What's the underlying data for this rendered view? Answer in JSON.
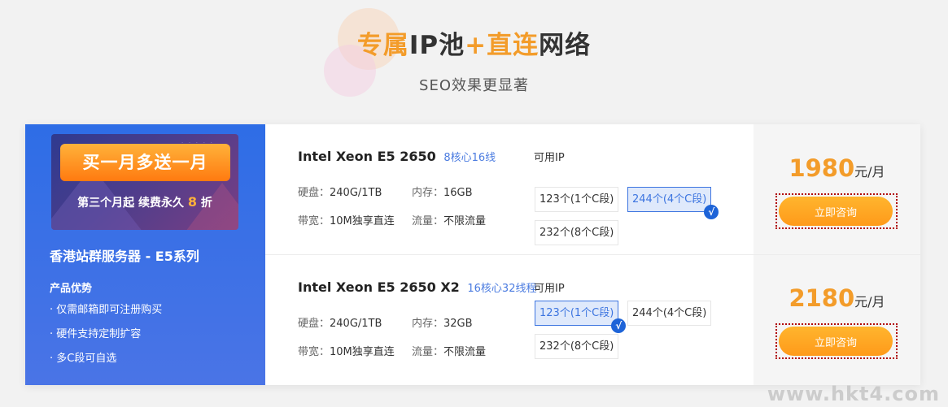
{
  "header": {
    "title_part1": "专属",
    "title_part2": "IP池",
    "title_plus": "+",
    "title_part3": "直连",
    "title_part4": "网络",
    "subtitle": "SEO效果更显著"
  },
  "colors": {
    "accent_orange": "#f39c2a",
    "brand_blue": "#2e6de6",
    "select_blue": "#3d75e0"
  },
  "side": {
    "banner_main": "买一月多送一月",
    "banner_sub_prefix": "第三个月起  续费永久",
    "banner_sub_num": "8",
    "banner_sub_suffix": "折",
    "title": "香港站群服务器 - E5系列",
    "advantages_heading": "产品优势",
    "advantages": [
      "· 仅需邮箱即可注册购买",
      "· 硬件支持定制扩容",
      "· 多C段可自选"
    ]
  },
  "products": [
    {
      "cpu": "Intel Xeon E5 2650",
      "cores": "8核心16线",
      "disk_label": "硬盘：",
      "disk": "240G/1TB",
      "mem_label": "内存：",
      "mem": "16GB",
      "bw_label": "带宽：",
      "bw": "10M独享直连",
      "traffic_label": "流量：",
      "traffic": "不限流量",
      "ip_label": "可用IP",
      "ip_options": [
        "123个(1个C段)",
        "244个(4个C段)",
        "232个(8个C段)"
      ],
      "price": "1980",
      "unit": "元/月",
      "consult": "立即咨询"
    },
    {
      "cpu": "Intel Xeon E5 2650 X2",
      "cores": "16核心32线程",
      "disk_label": "硬盘：",
      "disk": "240G/1TB",
      "mem_label": "内存：",
      "mem": "32GB",
      "bw_label": "带宽：",
      "bw": "10M独享直连",
      "traffic_label": "流量：",
      "traffic": "不限流量",
      "ip_label": "可用IP",
      "ip_options": [
        "123个(1个C段)",
        "244个(4个C段)",
        "232个(8个C段)"
      ],
      "price": "2180",
      "unit": "元/月",
      "consult": "立即咨询"
    }
  ],
  "check_glyph": "√",
  "watermark": "www.hkt4.com"
}
